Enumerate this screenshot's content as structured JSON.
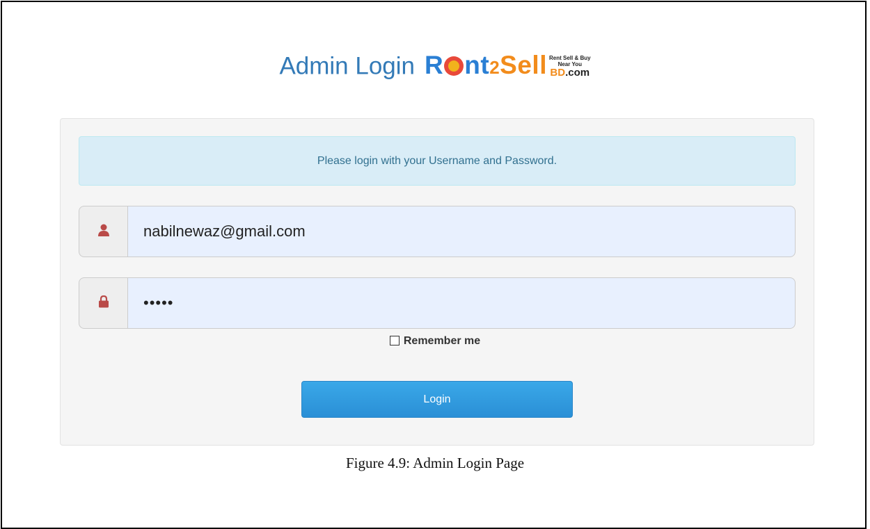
{
  "header": {
    "title": "Admin Login",
    "logo_part1": "R",
    "logo_part2": "nt",
    "logo_part3": "2",
    "logo_part4": "Sell",
    "logo_tagline1": "Rent Sell & Buy",
    "logo_tagline2": "Near You",
    "logo_domain_bd": "BD",
    "logo_domain_com": ".com"
  },
  "alert": {
    "message": "Please login with your Username and Password."
  },
  "form": {
    "username_value": "nabilnewaz@gmail.com",
    "password_value": "•••••",
    "remember_label": "Remember me",
    "login_label": "Login"
  },
  "caption": "Figure 4.9: Admin Login Page",
  "colors": {
    "title": "#337ab7",
    "logo_blue": "#2a7fd4",
    "logo_orange": "#f28c1c",
    "alert_bg": "#d9edf7",
    "button": "#2a8fd6",
    "icon": "#b94a48"
  },
  "icons": {
    "username": "user-icon",
    "password": "lock-icon"
  }
}
